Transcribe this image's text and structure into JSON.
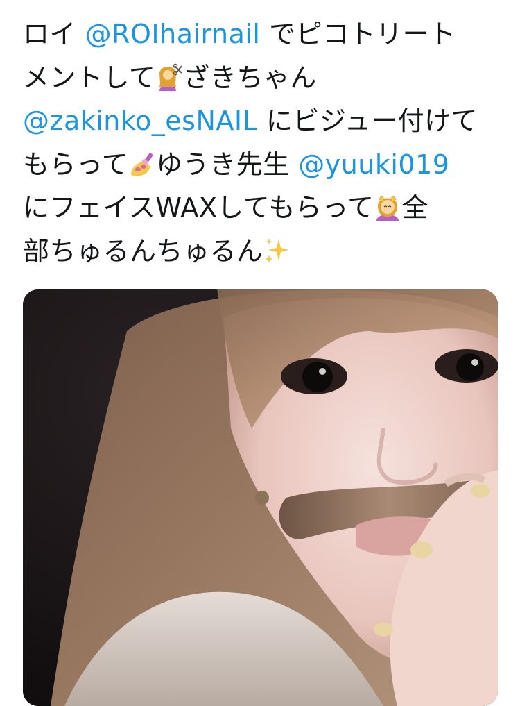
{
  "tweet": {
    "lines": [
      [
        {
          "t": "text",
          "v": "ロイ "
        },
        {
          "t": "mention",
          "v": "@ROIhairnail"
        },
        {
          "t": "text",
          "v": " でピコトリート"
        }
      ],
      [
        {
          "t": "text",
          "v": "メントして"
        },
        {
          "t": "emoji",
          "v": "haircut-emoji"
        },
        {
          "t": "text",
          "v": "ざきちゃん"
        }
      ],
      [
        {
          "t": "mention",
          "v": "@zakinko_esNAIL"
        },
        {
          "t": "text",
          "v": " にビジュー付けて"
        }
      ],
      [
        {
          "t": "text",
          "v": "もらって"
        },
        {
          "t": "emoji",
          "v": "nail-polish-emoji"
        },
        {
          "t": "text",
          "v": "ゆうき先生 "
        },
        {
          "t": "mention",
          "v": "@yuuki019"
        }
      ],
      [
        {
          "t": "text",
          "v": "にフェイスWAXしてもらって"
        },
        {
          "t": "emoji",
          "v": "face-massage-emoji"
        },
        {
          "t": "text",
          "v": "全"
        }
      ],
      [
        {
          "t": "text",
          "v": "部ちゅるんちゅるん"
        },
        {
          "t": "emoji",
          "v": "sparkles-emoji"
        }
      ]
    ]
  },
  "colors": {
    "text": "#14171a",
    "mention": "#1b95e0",
    "background": "#ffffff"
  },
  "media": {
    "icon": "selfie-photo"
  }
}
